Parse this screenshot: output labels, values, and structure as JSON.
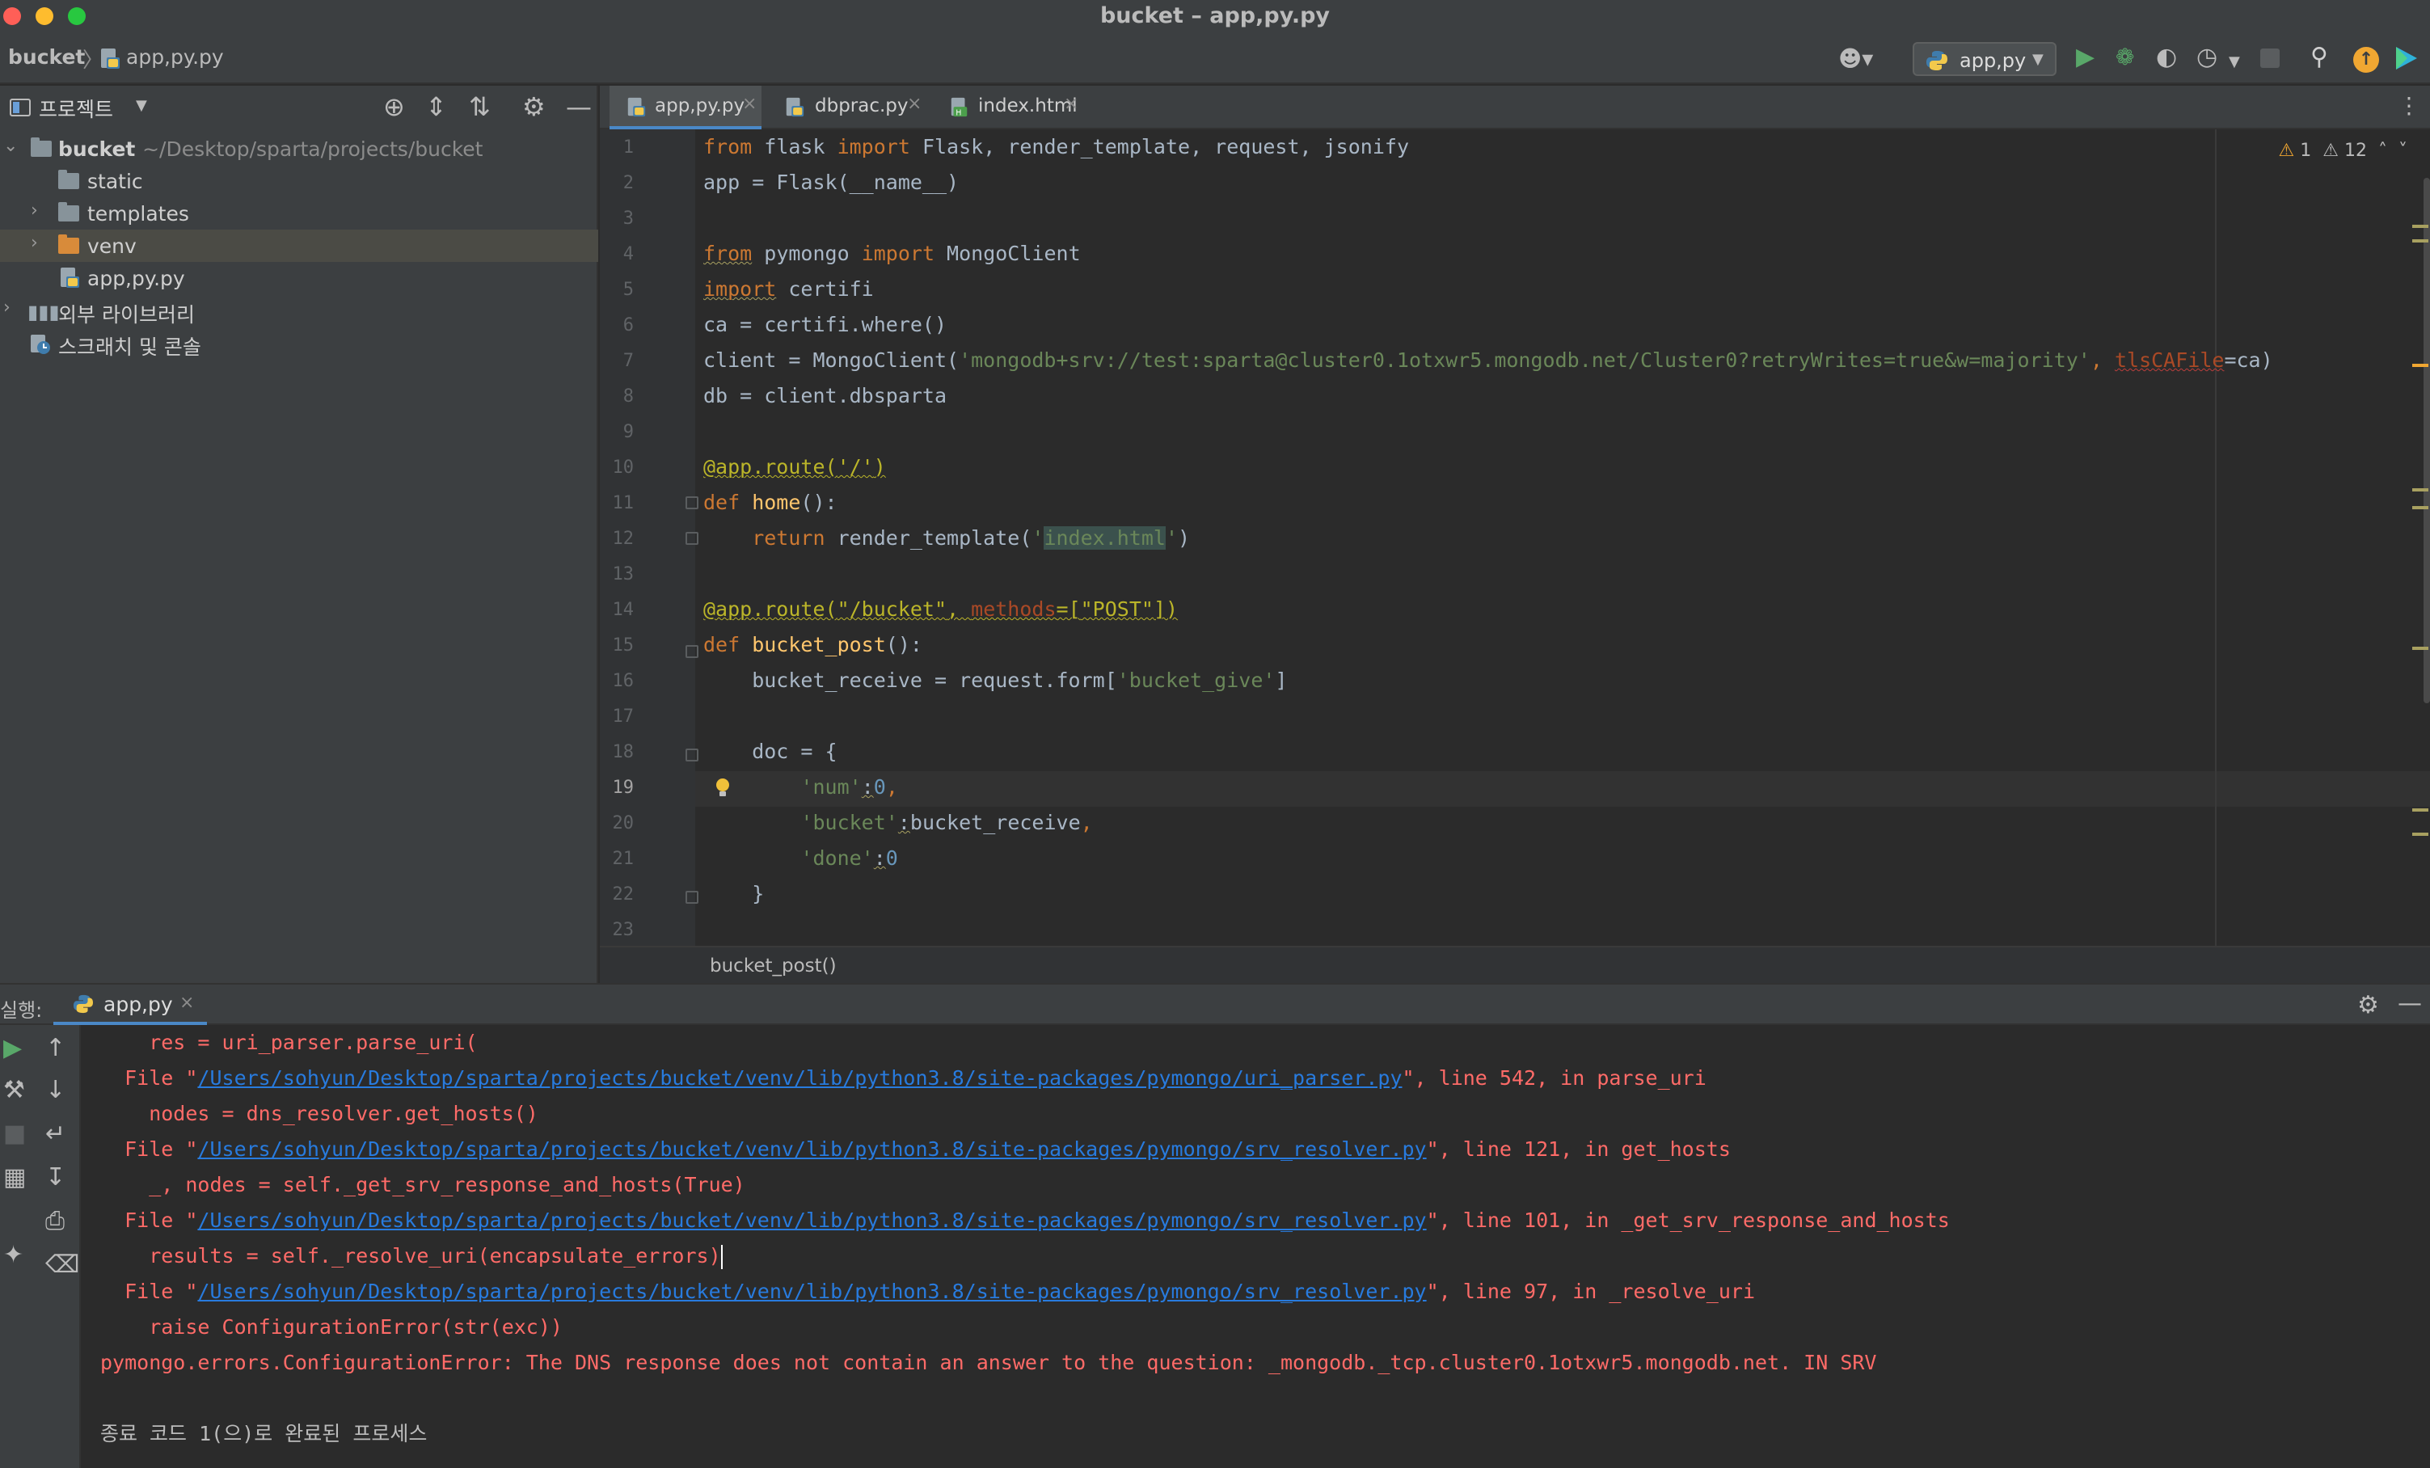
{
  "window": {
    "title": "bucket – app,py.py"
  },
  "navbar": {
    "project": "bucket",
    "separator": "〉",
    "file": "app,py.py",
    "run_config": "app,py"
  },
  "project_panel": {
    "title": "프로젝트",
    "tree": [
      {
        "label": "bucket",
        "sub": "~/Desktop/sparta/projects/bucket"
      },
      {
        "label": "static"
      },
      {
        "label": "templates"
      },
      {
        "label": "venv"
      },
      {
        "label": "app,py.py"
      },
      {
        "label": "외부 라이브러리"
      },
      {
        "label": "스크래치 및 콘솔"
      }
    ]
  },
  "tabs": [
    {
      "label": "app,py.py",
      "active": true
    },
    {
      "label": "dbprac.py",
      "active": false
    },
    {
      "label": "index.html",
      "active": false
    }
  ],
  "editor": {
    "inspections": {
      "warnings": "1",
      "weak_warnings": "12"
    },
    "current_line": 19,
    "line_numbers": [
      "1",
      "2",
      "3",
      "4",
      "5",
      "6",
      "7",
      "8",
      "9",
      "10",
      "11",
      "12",
      "13",
      "14",
      "15",
      "16",
      "17",
      "18",
      "19",
      "20",
      "21",
      "22",
      "23"
    ],
    "code": {
      "l1_from": "from",
      "l1_mod": " flask ",
      "l1_import": "import",
      "l1_rest": " Flask, render_template, request, jsonify",
      "l2": "app = Flask(__name__)",
      "l4_from": "from",
      "l4_mod": " pymongo ",
      "l4_import": "import",
      "l4_rest": " MongoClient",
      "l5_import": "import",
      "l5_rest": " certifi",
      "l6": "ca = certifi.where()",
      "l7_pre": "client = MongoClient(",
      "l7_str": "'mongodb+srv://test:sparta@cluster0.1otxwr5.mongodb.net/Cluster0?retryWrites=true&w=majority'",
      "l7_mid": ", ",
      "l7_param": "tlsCAFile",
      "l7_post": "=ca)",
      "l8": "db = client.dbsparta",
      "l10_deco": "@app.route(",
      "l10_str": "'/'",
      "l10_end": ")",
      "l11_def": "def",
      "l11_fn": " home",
      "l11_rest": "():",
      "l12_ret": "    return",
      "l12_pre": " render_template(",
      "l12_q1": "'",
      "l12_hl": "index.html",
      "l12_q2": "'",
      "l12_end": ")",
      "l14_deco": "@app.route(",
      "l14_str": "\"/bucket\"",
      "l14_comma": ", ",
      "l14_param": "methods",
      "l14_eq": "=[",
      "l14_str2": "\"POST\"",
      "l14_end": "])",
      "l15_def": "def",
      "l15_fn": " bucket_post",
      "l15_rest": "():",
      "l16_pre": "    bucket_receive = request.form[",
      "l16_str": "'bucket_give'",
      "l16_end": "]",
      "l18": "    doc = {",
      "l19_ind": "        ",
      "l19_str": "'num'",
      "l19_colon": ":",
      "l19_val": "0",
      "l19_end": ",",
      "l20_ind": "        ",
      "l20_str": "'bucket'",
      "l20_colon": ":",
      "l20_val": "bucket_receive",
      "l20_end": ",",
      "l21_ind": "        ",
      "l21_str": "'done'",
      "l21_colon": ":",
      "l21_val": "0",
      "l22": "    }"
    },
    "breadcrumb": "bucket_post()"
  },
  "run_panel": {
    "title": "실행:",
    "tab": "app,py",
    "console": {
      "c1": "    res = uri_parser.parse_uri(",
      "c2_pre": "  File \"",
      "c2_link": "/Users/sohyun/Desktop/sparta/projects/bucket/venv/lib/python3.8/site-packages/pymongo/uri_parser.py",
      "c2_post": "\", line 542, in parse_uri",
      "c3": "    nodes = dns_resolver.get_hosts()",
      "c4_pre": "  File \"",
      "c4_link": "/Users/sohyun/Desktop/sparta/projects/bucket/venv/lib/python3.8/site-packages/pymongo/srv_resolver.py",
      "c4_post": "\", line 121, in get_hosts",
      "c5": "    _, nodes = self._get_srv_response_and_hosts(True)",
      "c6_pre": "  File \"",
      "c6_link": "/Users/sohyun/Desktop/sparta/projects/bucket/venv/lib/python3.8/site-packages/pymongo/srv_resolver.py",
      "c6_post": "\", line 101, in _get_srv_response_and_hosts",
      "c7": "    results = self._resolve_uri(encapsulate_errors)",
      "c8_pre": "  File \"",
      "c8_link": "/Users/sohyun/Desktop/sparta/projects/bucket/venv/lib/python3.8/site-packages/pymongo/srv_resolver.py",
      "c8_post": "\", line 97, in _resolve_uri",
      "c9": "    raise ConfigurationError(str(exc))",
      "c10": "pymongo.errors.ConfigurationError: The DNS response does not contain an answer to the question: _mongodb._tcp.cluster0.1otxwr5.mongodb.net. IN SRV",
      "c12": "종료 코드 1(으)로 완료된 프로세스"
    }
  },
  "colors": {
    "accent": "#4a88c7",
    "run_green": "#59a869",
    "error_text": "#ff6b68",
    "link": "#287bde",
    "warning": "#f0a732"
  }
}
